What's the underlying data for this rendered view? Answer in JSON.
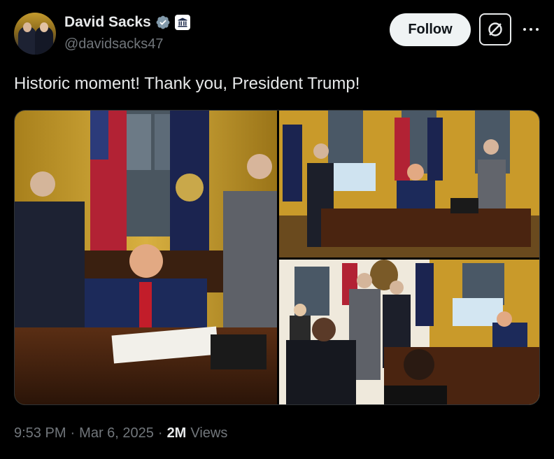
{
  "author": {
    "display_name": "David Sacks",
    "handle": "@davidsacks47",
    "verified_icon": "verified-badge-icon",
    "affiliate_icon": "government-building-icon"
  },
  "actions": {
    "follow_label": "Follow",
    "grok_icon": "grok-icon",
    "more_icon": "more-icon"
  },
  "tweet": {
    "text": "Historic moment! Thank you, President Trump!"
  },
  "media": {
    "photos": [
      {
        "icon": "oval-office-signing-photo"
      },
      {
        "icon": "oval-office-desk-photo"
      },
      {
        "icon": "oval-office-meeting-photo"
      }
    ]
  },
  "meta": {
    "time": "9:53 PM",
    "separator": "·",
    "date": "Mar 6, 2025",
    "views_count": "2M",
    "views_label": "Views"
  },
  "colors": {
    "background": "#000000",
    "text": "#e7e9ea",
    "muted": "#71767b",
    "verified": "#829aab",
    "follow_bg": "#eff3f4"
  }
}
